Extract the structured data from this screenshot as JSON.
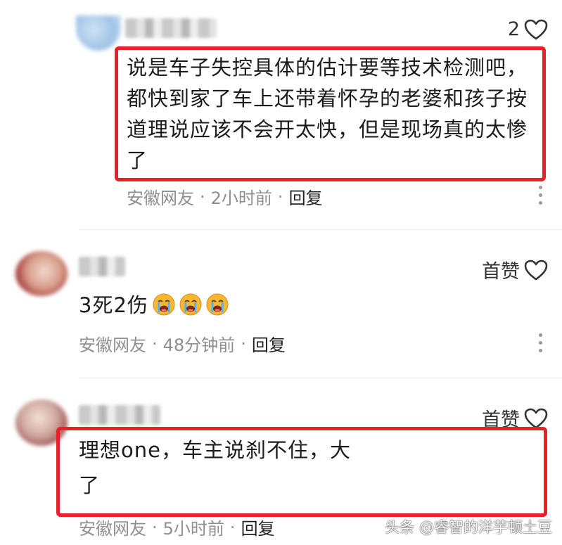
{
  "comments": [
    {
      "like": "2",
      "text": "说是车子失控具体的估计要等技术检测吧，都快到家了车上还带着怀孕的老婆和孩子按道理说应该不会开太快，但是现场真的太惨了",
      "line1": "说是车子失控具体的估计要等技术检测吧，",
      "line2": "都快到家了车上还带着怀孕的老婆和孩子按",
      "line3": "道理说应该不会开太快，但是现场真的太惨",
      "line4": "了",
      "location": "安徽网友",
      "time": "2小时前",
      "reply": "回复"
    },
    {
      "like": "首赞",
      "text": "3死2伤",
      "emoji_count": 3,
      "location": "安徽网友",
      "time": "48分钟前",
      "reply": "回复"
    },
    {
      "like": "首赞",
      "line1": "理想one，车主说刹不住，大",
      "line2": "了",
      "location": "安徽网友",
      "time": "5小时前",
      "reply": "回复"
    }
  ],
  "watermark": "头条 @睿智的洋芋顿土豆",
  "colors": {
    "highlight": "#e8202a",
    "meta": "#8f8f8f",
    "divider": "#ececec"
  },
  "icons": {
    "like": "heart-outline-icon",
    "more": "more-vertical-icon",
    "emoji": "crying-face-icon"
  }
}
